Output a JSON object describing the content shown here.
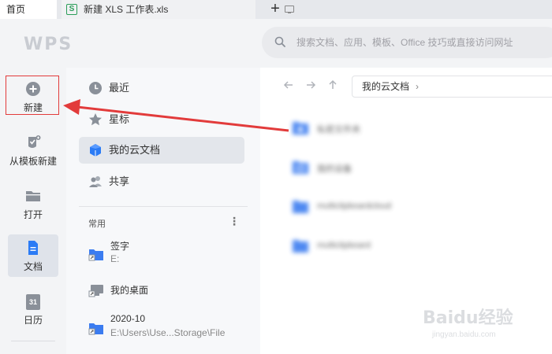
{
  "tabs": {
    "home": "首页",
    "document": "新建 XLS 工作表.xls",
    "add": "+"
  },
  "header": {
    "logo_text": "WPS",
    "search_placeholder": "搜索文档、应用、模板、Office 技巧或直接访问网址"
  },
  "leftnav": {
    "items": [
      {
        "label": "新建",
        "icon": "plus-circle-icon"
      },
      {
        "label": "从模板新建",
        "icon": "template-icon"
      },
      {
        "label": "打开",
        "icon": "folder-open-icon"
      },
      {
        "label": "文档",
        "icon": "document-icon"
      },
      {
        "label": "日历",
        "icon": "calendar-icon",
        "icon_text": "31"
      }
    ]
  },
  "midpanel": {
    "items": [
      {
        "label": "最近",
        "icon": "clock-icon"
      },
      {
        "label": "星标",
        "icon": "star-icon"
      },
      {
        "label": "我的云文档",
        "icon": "cloud-box-icon"
      },
      {
        "label": "共享",
        "icon": "people-icon"
      }
    ],
    "section_title": "常用",
    "more": "⋮",
    "favorites": [
      {
        "name": "签字",
        "path": "E:"
      },
      {
        "name": "我的桌面",
        "path": ""
      },
      {
        "name": "2020-10",
        "path": "E:\\Users\\Use...Storage\\File"
      }
    ]
  },
  "main": {
    "breadcrumb": "我的云文档",
    "breadcrumb_chevron": "›",
    "files": [
      {
        "name": "私密文件夹"
      },
      {
        "name": "我的设备"
      },
      {
        "name": "multiclipboardcloud"
      },
      {
        "name": "multiclipboard"
      }
    ]
  },
  "watermark": {
    "brand": "Baidu经验",
    "site": "jingyan.baidu.com"
  },
  "colors": {
    "accent": "#2b7bf5",
    "highlight": "#e23b3b",
    "folder": "#3b7cf0"
  }
}
